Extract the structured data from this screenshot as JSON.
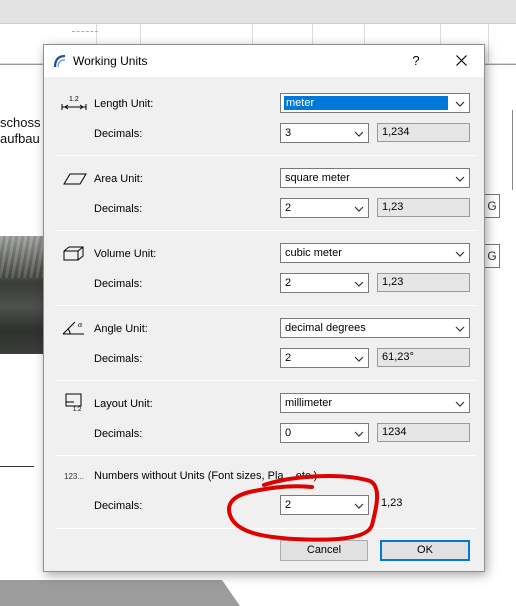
{
  "background": {
    "text_line1": "schoss",
    "text_line2": "aufbau",
    "side_box_letter": "G"
  },
  "dialog": {
    "title": "Working Units",
    "help_label": "?",
    "decimals_label": "Decimals:",
    "length": {
      "icon": "length-unit-icon",
      "label": "Length Unit:",
      "unit": "meter",
      "decimals": "3",
      "preview": "1,234"
    },
    "area": {
      "icon": "area-unit-icon",
      "label": "Area Unit:",
      "unit": "square meter",
      "decimals": "2",
      "preview": "1,23"
    },
    "volume": {
      "icon": "volume-unit-icon",
      "label": "Volume Unit:",
      "unit": "cubic meter",
      "decimals": "2",
      "preview": "1,23"
    },
    "angle": {
      "icon": "angle-unit-icon",
      "label": "Angle Unit:",
      "unit": "decimal degrees",
      "decimals": "2",
      "preview": "61,23°"
    },
    "layout": {
      "icon": "layout-unit-icon",
      "label": "Layout Unit:",
      "unit": "millimeter",
      "decimals": "0",
      "preview": "1234"
    },
    "numbers": {
      "icon": "numbers-icon",
      "icon_text": "123...",
      "label": "Numbers without Units (Font sizes, Pla... etc.)",
      "decimals": "2",
      "preview": "1,23"
    },
    "cancel_label": "Cancel",
    "ok_label": "OK"
  },
  "colors": {
    "selection": "#0078d7",
    "annotation_red": "#e00000",
    "dialog_bg": "#f0f0f0"
  }
}
